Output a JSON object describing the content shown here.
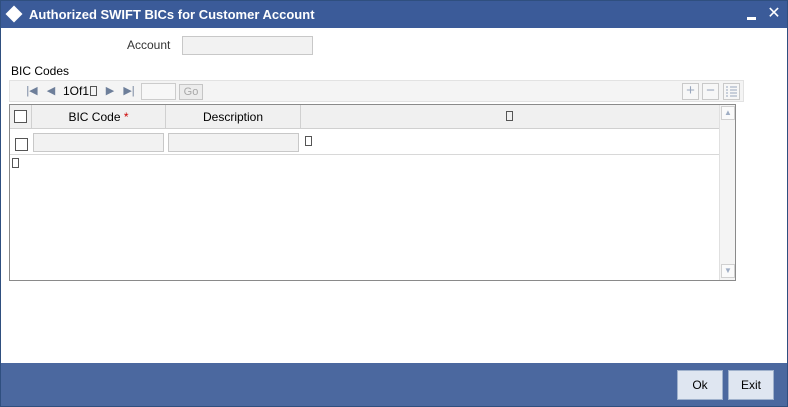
{
  "window": {
    "title": "Authorized SWIFT BICs for Customer Account",
    "close_glyph": "✕",
    "colors": {
      "titlebar": "#3b5b99",
      "footer": "#4b689f",
      "required": "#cc0000"
    }
  },
  "form": {
    "account_label": "Account",
    "account_value": ""
  },
  "section": {
    "title": "BIC Codes"
  },
  "pager": {
    "page_text": "1Of1",
    "goto_value": "",
    "go_label": "Go",
    "icons": [
      "first-page-icon",
      "prev-page-icon",
      "next-page-icon",
      "last-page-icon",
      "add-row-icon",
      "delete-row-icon",
      "single-view-icon"
    ],
    "add_glyph": "+",
    "delete_glyph": "−",
    "first_glyph": "|◀",
    "prev_glyph": "◀",
    "next_glyph": "▶",
    "last_glyph": "▶|"
  },
  "grid": {
    "columns": [
      "BIC Code",
      "Description"
    ],
    "required_marker": "*",
    "rows": [
      {
        "bic_code": "",
        "description": ""
      }
    ],
    "scroll_up_glyph": "▲",
    "scroll_down_glyph": "▼"
  },
  "footer": {
    "ok_label": "Ok",
    "exit_label": "Exit"
  }
}
